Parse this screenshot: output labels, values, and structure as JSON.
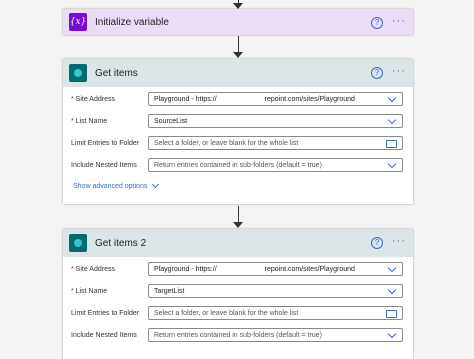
{
  "var_card": {
    "title": "Initialize variable",
    "icon": "variable-icon"
  },
  "card1": {
    "title": "Get items",
    "icon": "sharepoint-icon",
    "fields": [
      {
        "label": "* Site Address",
        "value": "Playground - https://",
        "value_suffix": "repoint.com/sites/Playground",
        "placeholder": false,
        "control": "dropdown"
      },
      {
        "label": "* List Name",
        "value": "SourceList",
        "placeholder": false,
        "control": "dropdown"
      },
      {
        "label": "Limit Entries to Folder",
        "value": "Select a folder, or leave blank for the whole list",
        "placeholder": true,
        "control": "folder"
      },
      {
        "label": "Include Nested Items",
        "value": "Return entries contained in sub-folders (default = true)",
        "placeholder": true,
        "control": "dropdown"
      }
    ],
    "advanced_label": "Show advanced options"
  },
  "card2": {
    "title": "Get items 2",
    "icon": "sharepoint-icon",
    "fields": [
      {
        "label": "* Site Address",
        "value": "Playground - https://",
        "value_suffix": "repoint.com/sites/Playground",
        "placeholder": false,
        "control": "dropdown"
      },
      {
        "label": "* List Name",
        "value": "TargetList",
        "placeholder": false,
        "control": "dropdown"
      },
      {
        "label": "Limit Entries to Folder",
        "value": "Select a folder, or leave blank for the whole list",
        "placeholder": true,
        "control": "folder"
      },
      {
        "label": "Include Nested Items",
        "value": "Return entries contained in sub-folders (default = true)",
        "placeholder": true,
        "control": "dropdown"
      }
    ]
  },
  "header_actions": {
    "help_symbol": "?",
    "more_symbol": "···"
  },
  "var_symbol": "{x}",
  "colors": {
    "accent": "#3c6cc6",
    "variable": "#770bd6",
    "sharepoint": "#036c70",
    "required": "#a4262c"
  }
}
